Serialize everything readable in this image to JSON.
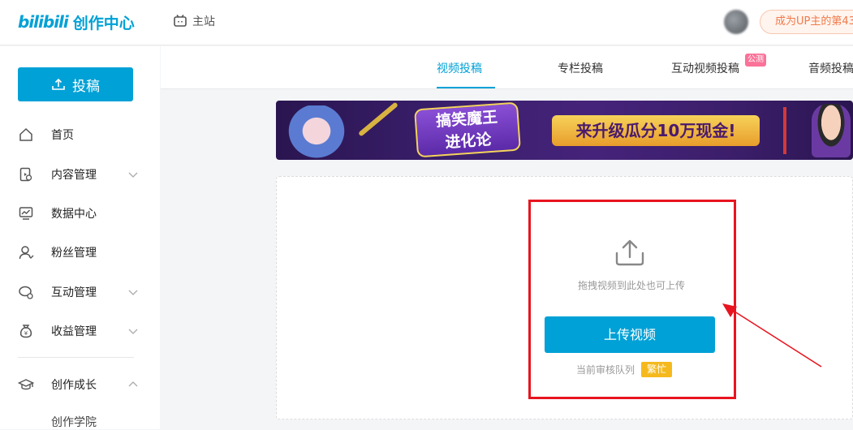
{
  "header": {
    "logo_text": "bilibili",
    "app_title": "创作中心",
    "home_label": "主站",
    "up_badge_text": "成为UP主的第43"
  },
  "sidebar": {
    "upload_button": "投稿",
    "items": [
      {
        "label": "首页",
        "icon": "home-icon",
        "expandable": false
      },
      {
        "label": "内容管理",
        "icon": "content-icon",
        "expandable": true
      },
      {
        "label": "数据中心",
        "icon": "chart-icon",
        "expandable": false
      },
      {
        "label": "粉丝管理",
        "icon": "fans-icon",
        "expandable": false
      },
      {
        "label": "互动管理",
        "icon": "chat-icon",
        "expandable": true
      },
      {
        "label": "收益管理",
        "icon": "money-bag-icon",
        "expandable": true
      },
      {
        "label": "创作成长",
        "icon": "graduation-cap-icon",
        "expandable": true,
        "expanded": true
      }
    ],
    "sub_items": [
      "创作学院"
    ]
  },
  "tabs": {
    "items": [
      "视频投稿",
      "专栏投稿",
      "互动视频投稿",
      "音频投稿"
    ],
    "active": "视频投稿",
    "beta_badge": "公测"
  },
  "banner": {
    "left_title_line1": "搞笑魔王",
    "left_title_line2": "进化论",
    "slogan": "来升级瓜分10万现金!"
  },
  "upload": {
    "drag_hint": "拖拽视频到此处也可上传",
    "button_label": "上传视频",
    "queue_label": "当前审核队列",
    "queue_status": "繁忙"
  },
  "colors": {
    "brand": "#00a1d6",
    "busy": "#f5b91d",
    "beta": "#fb7299",
    "annotation": "#e8141f"
  }
}
